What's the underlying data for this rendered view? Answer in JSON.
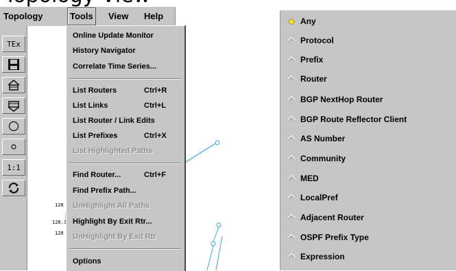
{
  "clipped_heading": "Topology View",
  "menubar": {
    "items": [
      {
        "id": "topology",
        "label": "Topology"
      },
      {
        "id": "tools",
        "label": "Tools"
      },
      {
        "id": "view",
        "label": "View"
      },
      {
        "id": "help",
        "label": "Help"
      }
    ]
  },
  "toolbar": {
    "buttons": [
      {
        "name": "text-label-button",
        "label": "TEx",
        "icon": "text-icon"
      },
      {
        "name": "save-button",
        "label": "",
        "icon": "floppy-disk-icon"
      },
      {
        "name": "home-button",
        "label": "",
        "icon": "house-icon"
      },
      {
        "name": "home-alt-button",
        "label": "",
        "icon": "house-alt-icon"
      },
      {
        "name": "large-circle-button",
        "label": "",
        "icon": "large-circle-icon"
      },
      {
        "name": "small-circle-button",
        "label": "",
        "icon": "small-circle-icon"
      },
      {
        "name": "zoom-1-1-button",
        "label": "1:1",
        "icon": "zoom-ratio-icon"
      },
      {
        "name": "refresh-button",
        "label": "",
        "icon": "refresh-icon"
      }
    ]
  },
  "canvas": {
    "ip_labels": [
      "128",
      "128.32",
      "128"
    ]
  },
  "tools_menu": {
    "items": [
      {
        "label": "Online Update Monitor",
        "accel": "",
        "enabled": true
      },
      {
        "label": "History Navigator",
        "accel": "",
        "enabled": true
      },
      {
        "label": "Correlate Time Series...",
        "accel": "",
        "enabled": true
      },
      {
        "label": "List Routers",
        "accel": "Ctrl+R",
        "enabled": true
      },
      {
        "label": "List Links",
        "accel": "Ctrl+L",
        "enabled": true
      },
      {
        "label": "List Router / Link Edits",
        "accel": "",
        "enabled": true
      },
      {
        "label": "List Prefixes",
        "accel": "Ctrl+X",
        "enabled": true
      },
      {
        "label": "List Highlighted Paths",
        "accel": "",
        "enabled": false
      },
      {
        "label": "Find Router...",
        "accel": "Ctrl+F",
        "enabled": true
      },
      {
        "label": "Find Prefix Path...",
        "accel": "",
        "enabled": true
      },
      {
        "label": "UnHighlight All Paths",
        "accel": "",
        "enabled": false
      },
      {
        "label": "Highlight By Exit Rtr...",
        "accel": "",
        "enabled": true
      },
      {
        "label": "UnHighlight By Exit Rtr",
        "accel": "",
        "enabled": false
      },
      {
        "label": "Options",
        "accel": "",
        "enabled": true
      }
    ]
  },
  "query_type_options": {
    "selected": "Any",
    "items": [
      "Any",
      "Protocol",
      "Prefix",
      "Router",
      "BGP NextHop Router",
      "BGP Route Reflector Client",
      "AS Number",
      "Community",
      "MED",
      "LocalPref",
      "Adjacent Router",
      "OSPF Prefix Type",
      "Expression"
    ]
  },
  "colors": {
    "panel_bg": "#c6c6c6",
    "selected_radio": "#f3e23a",
    "link_line": "#3aa6e0"
  }
}
